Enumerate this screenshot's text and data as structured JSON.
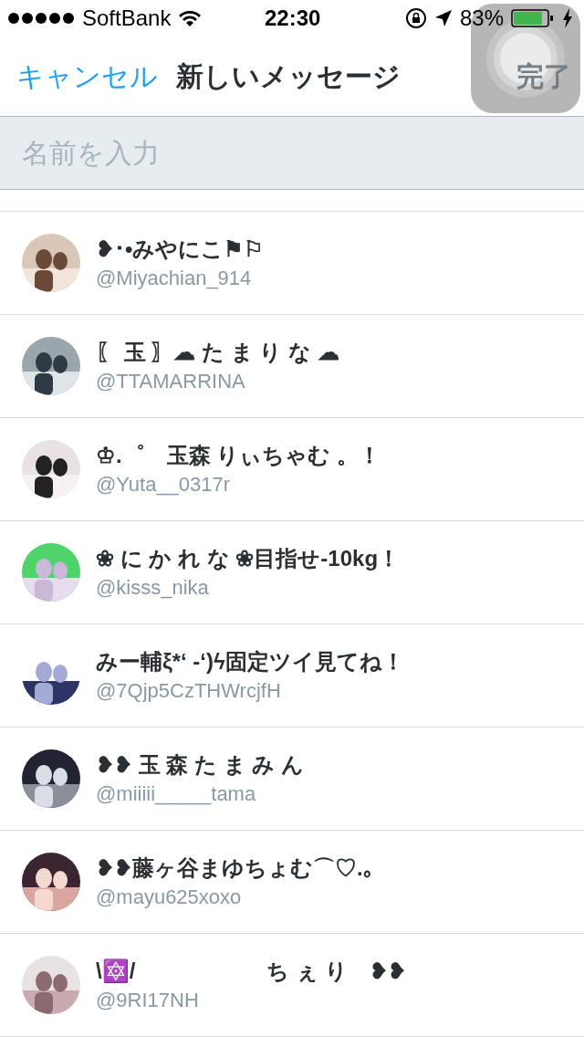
{
  "status_bar": {
    "carrier": "SoftBank",
    "time": "22:30",
    "battery": "83%"
  },
  "nav": {
    "cancel": "キャンセル",
    "title": "新しいメッセージ",
    "done": "完了"
  },
  "search": {
    "placeholder": "名前を入力"
  },
  "contacts": [
    {
      "name": "❥･•みやにこ⚑⚐",
      "handle": "@Miyachian_914"
    },
    {
      "name": "〖 玉 〗☁ た ま り な ☁",
      "handle": "@TTAMARRINA"
    },
    {
      "name": "♔.゜　玉森 りぃちゃむ 。！",
      "handle": "@Yuta__0317r"
    },
    {
      "name": "❀ に か れ な ❀目指せ-10kg！",
      "handle": "@kisss_nika"
    },
    {
      "name": "みー輔ξ*‘ -‘)ϟ固定ツイ見てね！",
      "handle": "@7Qjp5CzTHWrcjfH"
    },
    {
      "name": "❥❥ 玉 森 た ま み ん",
      "handle": "@miiiii_____tama"
    },
    {
      "name": "❥❥藤ヶ谷まゆちょむ⌒♡.｡",
      "handle": "@mayu625xoxo"
    },
    {
      "name": "\\🔯/　　　　　　ち ぇ り　❥❥",
      "handle": "@9RI17NH"
    }
  ]
}
